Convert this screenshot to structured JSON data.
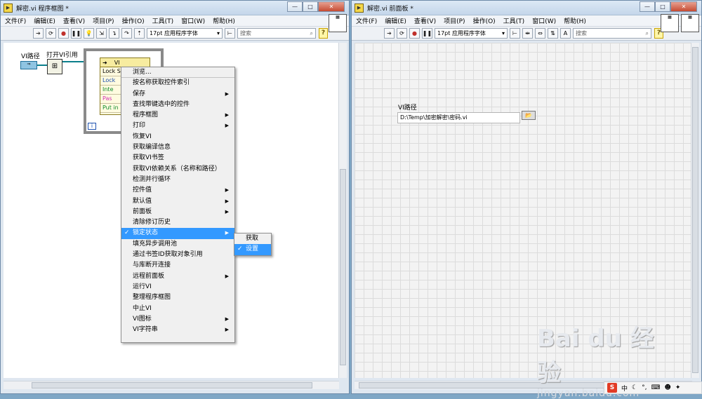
{
  "left_window": {
    "title": "解密.vi 程序框图 *",
    "menu": [
      "文件(F)",
      "编辑(E)",
      "查看(V)",
      "项目(P)",
      "操作(O)",
      "工具(T)",
      "窗口(W)",
      "帮助(H)"
    ],
    "font_select": "17pt 应用程序字体",
    "search_placeholder": "搜索",
    "diagram": {
      "path_label": "VI路径",
      "open_ref_label": "打开VI引用",
      "node_header": "VI",
      "node_rows": [
        "Lock S",
        "Lock",
        "Inte",
        "Pas",
        "Put in"
      ],
      "iter_label": "i"
    },
    "context_menu": [
      {
        "label": "浏览...",
        "submenu": false
      },
      {
        "label": "按名称获取控件索引",
        "submenu": false
      },
      {
        "label": "保存",
        "submenu": true
      },
      {
        "label": "查找带键选中的控件",
        "submenu": false
      },
      {
        "label": "程序框图",
        "submenu": true
      },
      {
        "label": "打印",
        "submenu": true
      },
      {
        "label": "恢复VI",
        "submenu": false
      },
      {
        "label": "获取编译信息",
        "submenu": false
      },
      {
        "label": "获取VI书签",
        "submenu": false
      },
      {
        "label": "获取VI依赖关系（名称和路径）",
        "submenu": false
      },
      {
        "label": "检测并行循环",
        "submenu": false
      },
      {
        "label": "控件值",
        "submenu": true
      },
      {
        "label": "默认值",
        "submenu": true
      },
      {
        "label": "前面板",
        "submenu": true
      },
      {
        "label": "清除修订历史",
        "submenu": false
      },
      {
        "label": "锁定状态",
        "submenu": true,
        "checked": true,
        "highlighted": true
      },
      {
        "label": "填充异步调用池",
        "submenu": false
      },
      {
        "label": "通过书签ID获取对象引用",
        "submenu": false
      },
      {
        "label": "与库断开连接",
        "submenu": false
      },
      {
        "label": "远程前面板",
        "submenu": true
      },
      {
        "label": "运行VI",
        "submenu": false
      },
      {
        "label": "整理程序框图",
        "submenu": false
      },
      {
        "label": "中止VI",
        "submenu": false
      },
      {
        "label": "VI图标",
        "submenu": true
      },
      {
        "label": "VI字符串",
        "submenu": true
      }
    ],
    "submenu": [
      {
        "label": "获取"
      },
      {
        "label": "设置",
        "checked": true,
        "highlighted": true
      }
    ]
  },
  "right_window": {
    "title": "解密.vi 前面板 *",
    "menu": [
      "文件(F)",
      "编辑(E)",
      "查看(V)",
      "项目(P)",
      "操作(O)",
      "工具(T)",
      "窗口(W)",
      "帮助(H)"
    ],
    "font_select": "17pt 应用程序字体",
    "search_placeholder": "搜索",
    "path_label": "VI路径",
    "path_value": "D:\\Temp\\加密解密\\密码.vi"
  },
  "watermark": {
    "brand": "Bai du 经验",
    "url": "jingyan.baidu.com"
  },
  "tray": {
    "lang": "中"
  },
  "colors": {
    "highlight": "#3399ff",
    "wire": "#0b7f8b",
    "grid": "#dcdcdc"
  }
}
